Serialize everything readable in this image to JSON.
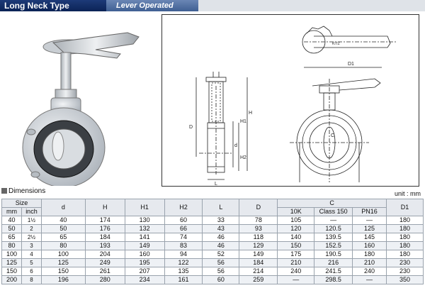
{
  "header": {
    "title": "Long Neck Type",
    "subtitle": "Lever Operated"
  },
  "drawing": {
    "labels": {
      "d1": "D1",
      "h": "H",
      "h1": "H1",
      "h2": "H2",
      "l": "L",
      "d": "D",
      "c": "C",
      "small_d": "d"
    },
    "logo_text": "KITZ"
  },
  "section": {
    "title": "Dimensions",
    "unit": "unit : mm"
  },
  "table": {
    "head": {
      "size": "Size",
      "mm": "mm",
      "inch": "inch",
      "d": "d",
      "h": "H",
      "h1": "H1",
      "h2": "H2",
      "l": "L",
      "dd": "D",
      "c": "C",
      "c_10k": "10K",
      "c_class150": "Class 150",
      "c_pn16": "PN16",
      "d1": "D1"
    },
    "rows": [
      {
        "mm": "40",
        "inch": "1½",
        "d": "40",
        "h": "174",
        "h1": "130",
        "h2": "60",
        "l": "33",
        "dd": "78",
        "k10": "105",
        "cl150": "—",
        "pn16": "—",
        "d1": "180"
      },
      {
        "mm": "50",
        "inch": "2",
        "d": "50",
        "h": "176",
        "h1": "132",
        "h2": "66",
        "l": "43",
        "dd": "93",
        "k10": "120",
        "cl150": "120.5",
        "pn16": "125",
        "d1": "180"
      },
      {
        "mm": "65",
        "inch": "2½",
        "d": "65",
        "h": "184",
        "h1": "141",
        "h2": "74",
        "l": "46",
        "dd": "118",
        "k10": "140",
        "cl150": "139.5",
        "pn16": "145",
        "d1": "180"
      },
      {
        "mm": "80",
        "inch": "3",
        "d": "80",
        "h": "193",
        "h1": "149",
        "h2": "83",
        "l": "46",
        "dd": "129",
        "k10": "150",
        "cl150": "152.5",
        "pn16": "160",
        "d1": "180"
      },
      {
        "mm": "100",
        "inch": "4",
        "d": "100",
        "h": "204",
        "h1": "160",
        "h2": "94",
        "l": "52",
        "dd": "149",
        "k10": "175",
        "cl150": "190.5",
        "pn16": "180",
        "d1": "180"
      },
      {
        "mm": "125",
        "inch": "5",
        "d": "125",
        "h": "249",
        "h1": "195",
        "h2": "122",
        "l": "56",
        "dd": "184",
        "k10": "210",
        "cl150": "216",
        "pn16": "210",
        "d1": "230"
      },
      {
        "mm": "150",
        "inch": "6",
        "d": "150",
        "h": "261",
        "h1": "207",
        "h2": "135",
        "l": "56",
        "dd": "214",
        "k10": "240",
        "cl150": "241.5",
        "pn16": "240",
        "d1": "230"
      },
      {
        "mm": "200",
        "inch": "8",
        "d": "196",
        "h": "280",
        "h1": "234",
        "h2": "161",
        "l": "60",
        "dd": "259",
        "k10": "—",
        "cl150": "298.5",
        "pn16": "—",
        "d1": "350"
      }
    ]
  }
}
